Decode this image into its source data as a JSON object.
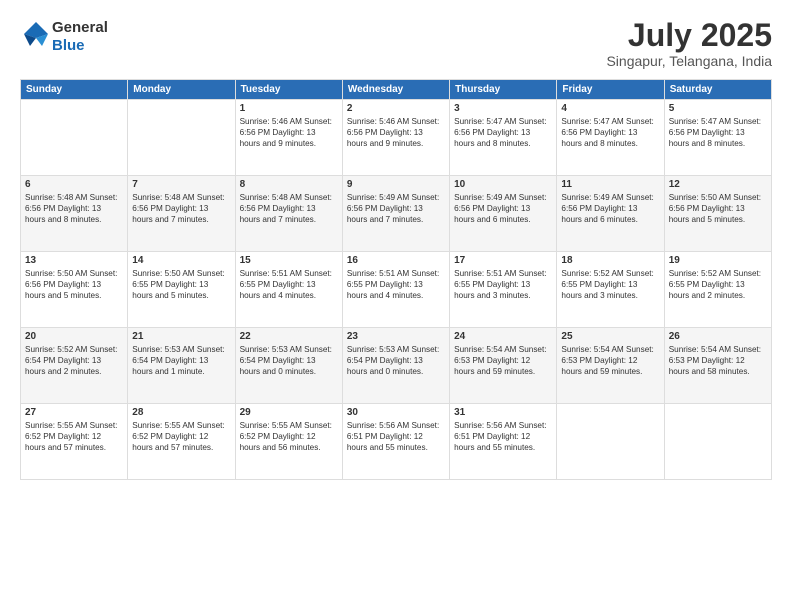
{
  "logo": {
    "general": "General",
    "blue": "Blue"
  },
  "title": {
    "month_year": "July 2025",
    "location": "Singapur, Telangana, India"
  },
  "days_of_week": [
    "Sunday",
    "Monday",
    "Tuesday",
    "Wednesday",
    "Thursday",
    "Friday",
    "Saturday"
  ],
  "weeks": [
    [
      {
        "day": "",
        "detail": ""
      },
      {
        "day": "",
        "detail": ""
      },
      {
        "day": "1",
        "detail": "Sunrise: 5:46 AM\nSunset: 6:56 PM\nDaylight: 13 hours\nand 9 minutes."
      },
      {
        "day": "2",
        "detail": "Sunrise: 5:46 AM\nSunset: 6:56 PM\nDaylight: 13 hours\nand 9 minutes."
      },
      {
        "day": "3",
        "detail": "Sunrise: 5:47 AM\nSunset: 6:56 PM\nDaylight: 13 hours\nand 8 minutes."
      },
      {
        "day": "4",
        "detail": "Sunrise: 5:47 AM\nSunset: 6:56 PM\nDaylight: 13 hours\nand 8 minutes."
      },
      {
        "day": "5",
        "detail": "Sunrise: 5:47 AM\nSunset: 6:56 PM\nDaylight: 13 hours\nand 8 minutes."
      }
    ],
    [
      {
        "day": "6",
        "detail": "Sunrise: 5:48 AM\nSunset: 6:56 PM\nDaylight: 13 hours\nand 8 minutes."
      },
      {
        "day": "7",
        "detail": "Sunrise: 5:48 AM\nSunset: 6:56 PM\nDaylight: 13 hours\nand 7 minutes."
      },
      {
        "day": "8",
        "detail": "Sunrise: 5:48 AM\nSunset: 6:56 PM\nDaylight: 13 hours\nand 7 minutes."
      },
      {
        "day": "9",
        "detail": "Sunrise: 5:49 AM\nSunset: 6:56 PM\nDaylight: 13 hours\nand 7 minutes."
      },
      {
        "day": "10",
        "detail": "Sunrise: 5:49 AM\nSunset: 6:56 PM\nDaylight: 13 hours\nand 6 minutes."
      },
      {
        "day": "11",
        "detail": "Sunrise: 5:49 AM\nSunset: 6:56 PM\nDaylight: 13 hours\nand 6 minutes."
      },
      {
        "day": "12",
        "detail": "Sunrise: 5:50 AM\nSunset: 6:56 PM\nDaylight: 13 hours\nand 5 minutes."
      }
    ],
    [
      {
        "day": "13",
        "detail": "Sunrise: 5:50 AM\nSunset: 6:56 PM\nDaylight: 13 hours\nand 5 minutes."
      },
      {
        "day": "14",
        "detail": "Sunrise: 5:50 AM\nSunset: 6:55 PM\nDaylight: 13 hours\nand 5 minutes."
      },
      {
        "day": "15",
        "detail": "Sunrise: 5:51 AM\nSunset: 6:55 PM\nDaylight: 13 hours\nand 4 minutes."
      },
      {
        "day": "16",
        "detail": "Sunrise: 5:51 AM\nSunset: 6:55 PM\nDaylight: 13 hours\nand 4 minutes."
      },
      {
        "day": "17",
        "detail": "Sunrise: 5:51 AM\nSunset: 6:55 PM\nDaylight: 13 hours\nand 3 minutes."
      },
      {
        "day": "18",
        "detail": "Sunrise: 5:52 AM\nSunset: 6:55 PM\nDaylight: 13 hours\nand 3 minutes."
      },
      {
        "day": "19",
        "detail": "Sunrise: 5:52 AM\nSunset: 6:55 PM\nDaylight: 13 hours\nand 2 minutes."
      }
    ],
    [
      {
        "day": "20",
        "detail": "Sunrise: 5:52 AM\nSunset: 6:54 PM\nDaylight: 13 hours\nand 2 minutes."
      },
      {
        "day": "21",
        "detail": "Sunrise: 5:53 AM\nSunset: 6:54 PM\nDaylight: 13 hours\nand 1 minute."
      },
      {
        "day": "22",
        "detail": "Sunrise: 5:53 AM\nSunset: 6:54 PM\nDaylight: 13 hours\nand 0 minutes."
      },
      {
        "day": "23",
        "detail": "Sunrise: 5:53 AM\nSunset: 6:54 PM\nDaylight: 13 hours\nand 0 minutes."
      },
      {
        "day": "24",
        "detail": "Sunrise: 5:54 AM\nSunset: 6:53 PM\nDaylight: 12 hours\nand 59 minutes."
      },
      {
        "day": "25",
        "detail": "Sunrise: 5:54 AM\nSunset: 6:53 PM\nDaylight: 12 hours\nand 59 minutes."
      },
      {
        "day": "26",
        "detail": "Sunrise: 5:54 AM\nSunset: 6:53 PM\nDaylight: 12 hours\nand 58 minutes."
      }
    ],
    [
      {
        "day": "27",
        "detail": "Sunrise: 5:55 AM\nSunset: 6:52 PM\nDaylight: 12 hours\nand 57 minutes."
      },
      {
        "day": "28",
        "detail": "Sunrise: 5:55 AM\nSunset: 6:52 PM\nDaylight: 12 hours\nand 57 minutes."
      },
      {
        "day": "29",
        "detail": "Sunrise: 5:55 AM\nSunset: 6:52 PM\nDaylight: 12 hours\nand 56 minutes."
      },
      {
        "day": "30",
        "detail": "Sunrise: 5:56 AM\nSunset: 6:51 PM\nDaylight: 12 hours\nand 55 minutes."
      },
      {
        "day": "31",
        "detail": "Sunrise: 5:56 AM\nSunset: 6:51 PM\nDaylight: 12 hours\nand 55 minutes."
      },
      {
        "day": "",
        "detail": ""
      },
      {
        "day": "",
        "detail": ""
      }
    ]
  ]
}
